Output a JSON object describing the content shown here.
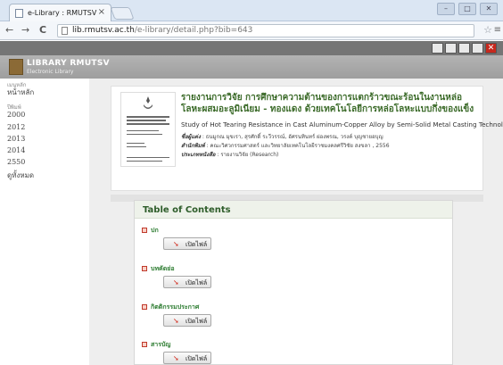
{
  "browser": {
    "tab_title": "e-Library : RMUTSV",
    "tab_close": "×",
    "url_domain": "lib.rmutsv.ac.th",
    "url_path": "/e-library/detail.php?bib=643",
    "nav": {
      "back": "←",
      "forward": "→",
      "reload": "C"
    },
    "window": {
      "minimize": "–",
      "maximize": "□",
      "close": "✕"
    }
  },
  "header": {
    "logo_title": "LIBRARY RMUTSV",
    "logo_subtitle": "Electronic Library"
  },
  "sidebar": {
    "menu_label": "เมนูหลัก",
    "home": "หน้าหลัก",
    "year_label": "ปีพิมพ์",
    "years": [
      "2000",
      "2012",
      "2013",
      "2014",
      "2550"
    ],
    "all": "ดูทั้งหมด"
  },
  "book": {
    "title_th": "รายงานการวิจัย การศึกษาความต้านของการแตกร้าวขณะร้อนในงานหล่อโลหะผสมอะลูมิเนียม - ทองแดง ด้วยเทคโนโลยีการหล่อโลหะแบบกึ่งของแข็ง",
    "title_en": "Study of Hot Tearing Resistance in Cast Aluminum-Copper Alloy by Semi-Solid Metal Casting Technology",
    "author_label": "ชื่อผู้แต่ง",
    "author": ": ธนมูกณ มุขเรา, สุรศักดิ์ ระวีวรรณ์, อัศรนทินทร์ ผ่องพรณ, วรงค์ บุญชายอบุญ",
    "publisher_label": "สำนักพิมพ์",
    "publisher": ": คณะวิศวกรรมศาสตร์ และวิทยาลัยเทคโนโลยีราชมงคลศรีวิชัย สงขลา , 2556",
    "type_label": "ประเภทหนังสือ",
    "type": ": รายงานวิจัย (Research)"
  },
  "toc": {
    "heading": "Table of Contents",
    "items": [
      {
        "label": "ปก",
        "button": "เปิดไฟล์"
      },
      {
        "label": "บทคัดย่อ",
        "button": "เปิดไฟล์"
      },
      {
        "label": "กิตติกรรมประกาศ",
        "button": "เปิดไฟล์"
      },
      {
        "label": "สารบัญ",
        "button": "เปิดไฟล์"
      }
    ]
  },
  "icons": {
    "favicon": "page-icon",
    "star": "bookmark-star-icon",
    "pdf": "pdf-icon"
  },
  "colors": {
    "title_green": "#3c6b2a",
    "toc_green": "#2e7d32",
    "header_gray": "#a8a8a8",
    "toolbar_gray": "#757575",
    "close_red": "#c7281d"
  }
}
